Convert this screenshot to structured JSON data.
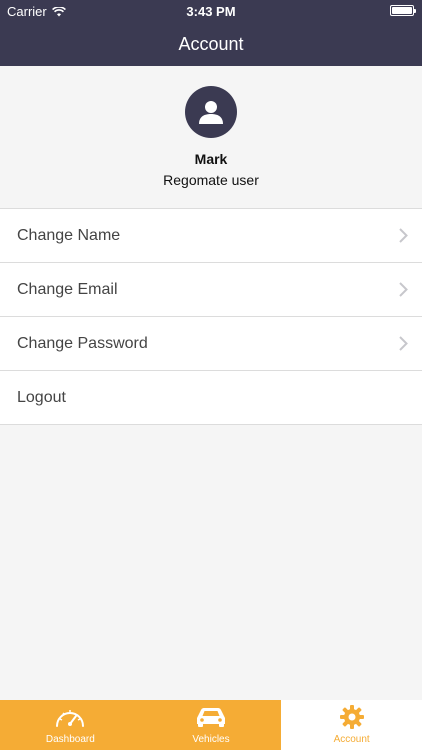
{
  "status": {
    "carrier": "Carrier",
    "time": "3:43 PM"
  },
  "nav": {
    "title": "Account"
  },
  "profile": {
    "name": "Mark",
    "role": "Regomate user"
  },
  "menu": [
    {
      "label": "Change Name"
    },
    {
      "label": "Change Email"
    },
    {
      "label": "Change Password"
    },
    {
      "label": "Logout"
    }
  ],
  "tabs": [
    {
      "label": "Dashboard",
      "icon": "speedometer-icon"
    },
    {
      "label": "Vehicles",
      "icon": "car-icon"
    },
    {
      "label": "Account",
      "icon": "gear-icon"
    }
  ],
  "colors": {
    "primary": "#3b3a52",
    "accent": "#f5ac35",
    "background": "#f5f5f5"
  }
}
